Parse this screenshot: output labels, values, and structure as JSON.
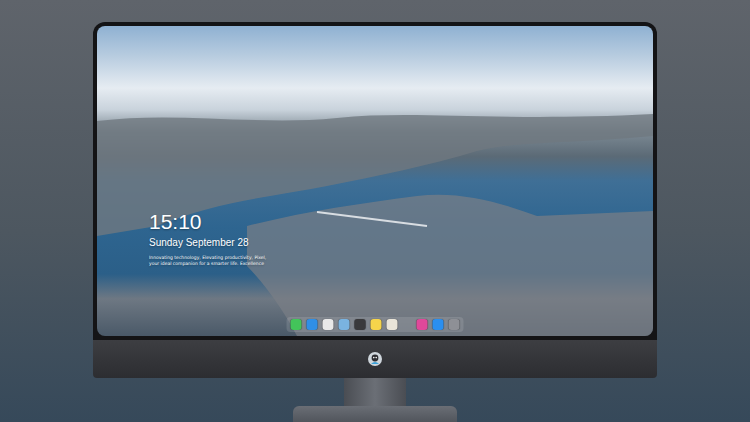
{
  "lock_screen": {
    "time": "15:10",
    "date": "Sunday September 28",
    "tagline_lines": [
      "Innovating technology, Elevating productivity, Pixel,",
      "your ideal companion for a smarter life. Excellence"
    ]
  },
  "dock": {
    "apps": [
      {
        "color": "#43c45a"
      },
      {
        "color": "#2f8fe6"
      },
      {
        "color": "#e8e8e8"
      },
      {
        "color": "#7ab3e0"
      },
      {
        "color": "#3a3a3c"
      },
      {
        "color": "#f5d44b"
      },
      {
        "color": "#e9e4d8"
      },
      {
        "color": "#e0489a"
      },
      {
        "color": "#2a8ff0"
      },
      {
        "color": "#8e9096"
      }
    ]
  }
}
